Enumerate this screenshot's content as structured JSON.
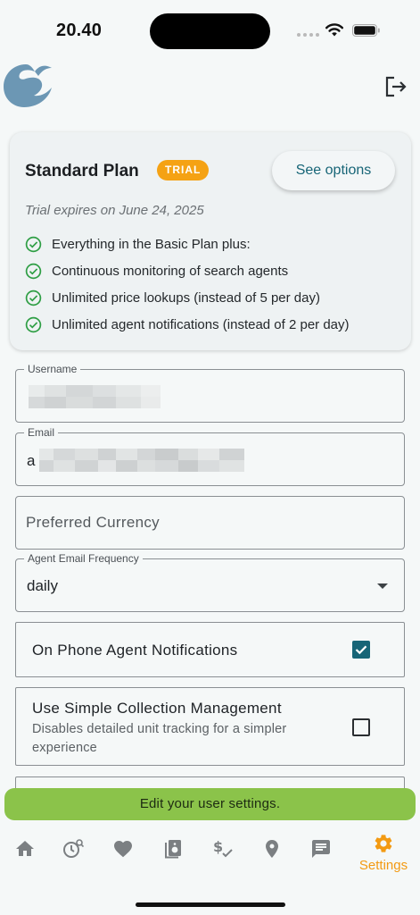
{
  "status_bar": {
    "time": "20.40"
  },
  "plan": {
    "title": "Standard Plan",
    "badge": "TRIAL",
    "see_options_label": "See options",
    "expiry": "Trial expires on June 24, 2025",
    "features": [
      "Everything in the Basic Plan plus:",
      "Continuous monitoring of search agents",
      "Unlimited price lookups (instead of 5 per day)",
      "Unlimited agent notifications (instead of 2 per day)"
    ]
  },
  "form": {
    "username": {
      "label": "Username",
      "value_first_char": ""
    },
    "email": {
      "label": "Email",
      "value_first_char": "a"
    },
    "currency": {
      "placeholder": "Preferred Currency"
    },
    "frequency": {
      "label": "Agent Email Frequency",
      "value": "daily"
    },
    "phone_notifications": {
      "label": "On Phone Agent Notifications",
      "checked": true
    },
    "simple_collection": {
      "label": "Use Simple Collection Management",
      "description": "Disables detailed unit tracking for a simpler experience",
      "checked": false
    }
  },
  "toast": {
    "message": "Edit your user settings."
  },
  "bottom_nav": {
    "items": [
      {
        "icon": "home-icon"
      },
      {
        "icon": "history-search-icon"
      },
      {
        "icon": "heart-icon"
      },
      {
        "icon": "collection-icon"
      },
      {
        "icon": "price-icon"
      },
      {
        "icon": "location-pin-icon"
      },
      {
        "icon": "chat-icon"
      }
    ],
    "active": {
      "icon": "gear-icon",
      "label": "Settings"
    }
  },
  "colors": {
    "accent": "#176577",
    "active_nav": "#f39a12",
    "trial_badge": "#f5a214",
    "toast": "#8bc34a",
    "check_green": "#2e9e44"
  }
}
